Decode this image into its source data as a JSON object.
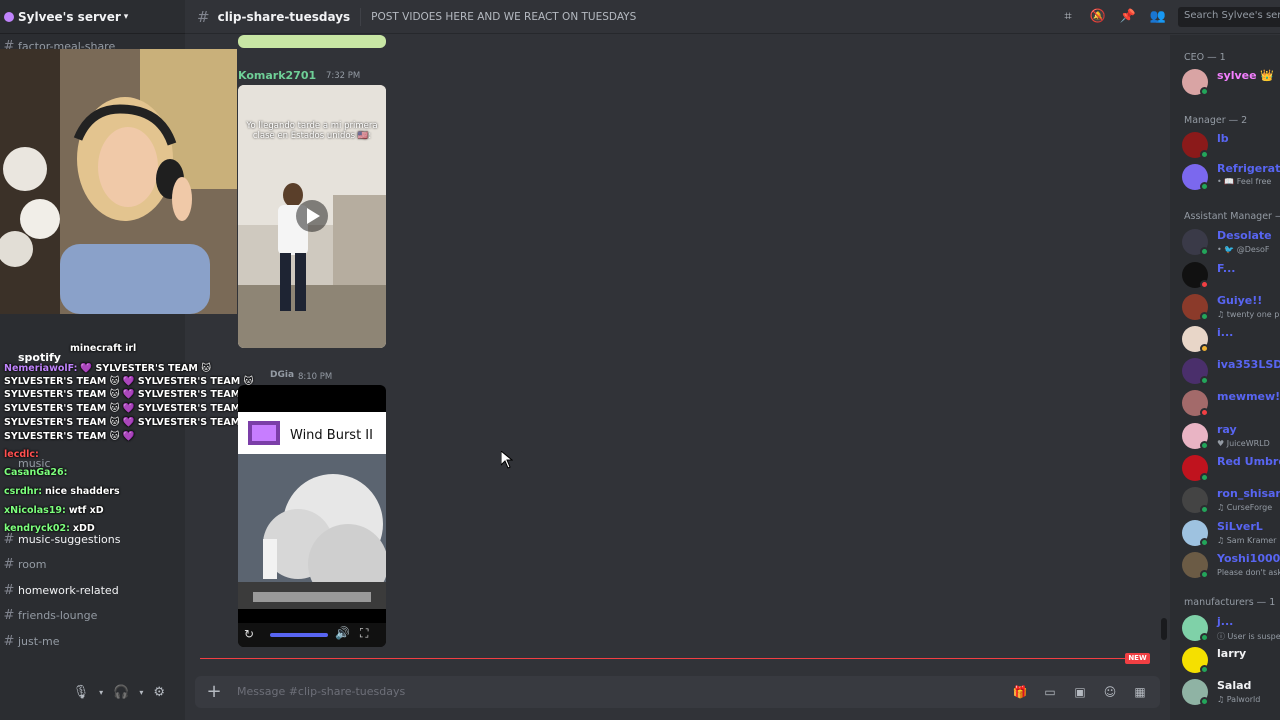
{
  "server": {
    "name": "Sylvee's server"
  },
  "channels": {
    "top_item": "factor-meal-share",
    "overlap_items": [
      "spotify",
      "music"
    ],
    "items": [
      "music-suggestions",
      "room",
      "homework-related",
      "friends-lounge",
      "just-me"
    ]
  },
  "stream_chat": [
    {
      "user": "NemeriawolF:",
      "text": "💜 SYLVESTER'S TEAM 🐱",
      "user_color": "#c084fc"
    },
    {
      "user": "",
      "text": "SYLVESTER'S TEAM 🐱 💜 SYLVESTER'S TEAM 🐱",
      "user_color": "#ffffff"
    },
    {
      "user": "",
      "text": "SYLVESTER'S TEAM 🐱 💜 SYLVESTER'S TEAM 🐱 💜 🐱 💜",
      "user_color": "#ffffff"
    },
    {
      "user": "",
      "text": "SYLVESTER'S TEAM 🐱 💜 SYLVESTER'S TEAM 🐱 💜",
      "user_color": "#ffffff"
    },
    {
      "user": "",
      "text": "SYLVESTER'S TEAM 🐱 💜 SYLVESTER'S TEAM 🐱 💜",
      "user_color": "#ffffff"
    },
    {
      "user": "",
      "text": "SYLVESTER'S TEAM 🐱 💜",
      "user_color": "#ffffff"
    },
    {
      "user": "minecraft irl",
      "text": "",
      "user_color": "#ffffff"
    },
    {
      "user": "lecdlc:",
      "text": "",
      "user_color": "#ff5050"
    },
    {
      "user": "CasanGa26:",
      "text": "",
      "user_color": "#7dff7d"
    },
    {
      "user": "csrdhr:",
      "text": "nice shadders",
      "user_color": "#7dff7d"
    },
    {
      "user": "xNicolas19:",
      "text": "wtf xD",
      "user_color": "#7dff7d"
    },
    {
      "user": "kendryck02:",
      "text": "xDD",
      "user_color": "#7dff7d"
    }
  ],
  "topbar": {
    "channel": "clip-share-tuesdays",
    "topic": "POST VIDOES HERE AND WE REACT ON TUESDAYS",
    "search_placeholder": "Search Sylvee's server"
  },
  "messages": [
    {
      "author": "Komark2701",
      "time": "7:32 PM",
      "author_color": "#6fcf97",
      "video_caption": "Yo llegando tarde a mi primera clase en Estados unidos 🇺🇸:"
    },
    {
      "author": "DGia",
      "time": "8:10 PM",
      "author_color": "#949ba4",
      "video_caption": "Wind Burst II"
    }
  ],
  "new_badge": "NEW",
  "composer": {
    "placeholder": "Message #clip-share-tuesdays"
  },
  "members": {
    "groups": [
      {
        "label": "CEO — 1",
        "members": [
          {
            "name": "sylvee 👑",
            "sub": "",
            "color": "#f47fff"
          }
        ]
      },
      {
        "label": "Manager — 2",
        "members": [
          {
            "name": "lb",
            "sub": "",
            "color": "#5865f2"
          },
          {
            "name": "Refrigerated",
            "sub": "• 📖 Feel free",
            "color": "#5865f2"
          }
        ]
      },
      {
        "label": "Assistant Manager —",
        "members": [
          {
            "name": "Desolate",
            "sub": "• 🐦 @DesoF",
            "color": "#5865f2"
          },
          {
            "name": "F...",
            "sub": "",
            "color": "#5865f2"
          },
          {
            "name": "Guiye!!",
            "sub": "♫ twenty one p",
            "color": "#5865f2"
          },
          {
            "name": "i...",
            "sub": "",
            "color": "#5865f2"
          },
          {
            "name": "iva353LSD",
            "sub": "",
            "color": "#5865f2"
          },
          {
            "name": "mewmew!",
            "sub": "",
            "color": "#5865f2"
          },
          {
            "name": "ray",
            "sub": "♥ JuiceWRLD",
            "color": "#5865f2"
          },
          {
            "name": "Red Umbrell",
            "sub": "",
            "color": "#5865f2"
          },
          {
            "name": "ron_shisan",
            "sub": "♫ CurseForge",
            "color": "#5865f2"
          },
          {
            "name": "SiLverL",
            "sub": "♫ Sam Kramer",
            "color": "#5865f2"
          },
          {
            "name": "Yoshi1000",
            "sub": "Please don't ask",
            "color": "#5865f2"
          }
        ]
      },
      {
        "label": "manufacturers — 1",
        "members": [
          {
            "name": "j...",
            "sub": "ⓘ User is suspe",
            "color": "#5865f2"
          },
          {
            "name": "larry",
            "sub": "",
            "color": "#f2f3f5"
          },
          {
            "name": "Salad",
            "sub": "♫ Palworld",
            "color": "#f2f3f5"
          }
        ]
      }
    ]
  },
  "colors": {
    "bg": "#313338",
    "sidebar": "#2b2d31",
    "accent": "#5865f2",
    "danger": "#f23f43"
  }
}
